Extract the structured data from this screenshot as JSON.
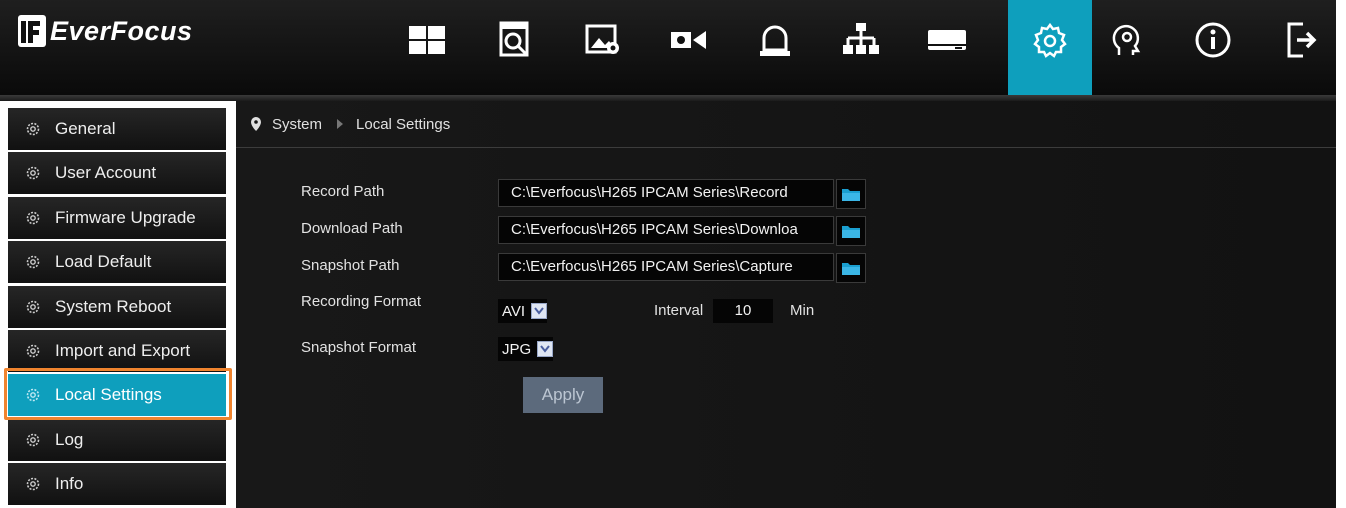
{
  "header": {
    "brand": "EverFocus",
    "nav_icons": [
      "grid-view-icon",
      "playback-search-icon",
      "picture-settings-icon",
      "camera-record-icon",
      "alarm-icon",
      "network-icon",
      "storage-icon",
      "settings-gear-icon",
      "diagnostic-icon",
      "information-icon",
      "logout-icon"
    ],
    "active_nav": "settings-gear-icon"
  },
  "sidebar": {
    "items": [
      {
        "label": "General"
      },
      {
        "label": "User Account"
      },
      {
        "label": "Firmware Upgrade"
      },
      {
        "label": "Load Default"
      },
      {
        "label": "System Reboot"
      },
      {
        "label": "Import and Export"
      },
      {
        "label": "Local Settings"
      },
      {
        "label": "Log"
      },
      {
        "label": "Info"
      }
    ],
    "active_item": "Local Settings"
  },
  "breadcrumb": {
    "root": "System",
    "current": "Local Settings"
  },
  "form": {
    "record_path": {
      "label": "Record Path",
      "value": "C:\\Everfocus\\H265 IPCAM Series\\Record"
    },
    "download_path": {
      "label": "Download Path",
      "value": "C:\\Everfocus\\H265 IPCAM Series\\Downloa"
    },
    "snapshot_path": {
      "label": "Snapshot Path",
      "value": "C:\\Everfocus\\H265 IPCAM Series\\Capture"
    },
    "recording_format": {
      "label": "Recording Format",
      "value": "AVI"
    },
    "interval": {
      "label": "Interval",
      "value": "10",
      "unit": "Min"
    },
    "snapshot_format": {
      "label": "Snapshot Format",
      "value": "JPG"
    },
    "apply_label": "Apply"
  },
  "colors": {
    "accent": "#0e9fbd",
    "highlight_border": "#f0842e",
    "apply_button": "#5c6a7c"
  }
}
